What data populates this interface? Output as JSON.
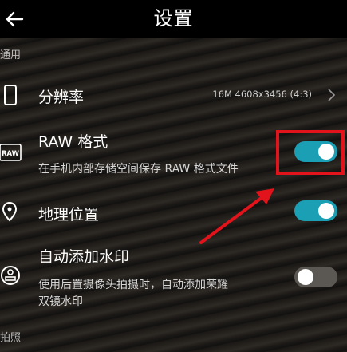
{
  "header": {
    "title": "设置"
  },
  "sections": {
    "general": "通用",
    "photo": "拍照"
  },
  "rows": {
    "resolution": {
      "label": "分辨率",
      "value": "16M 4608x3456 (4:3)"
    },
    "raw": {
      "label": "RAW 格式",
      "description": "在手机内部存储空间保存 RAW 格式文件",
      "icon_text": "RAW",
      "enabled": true
    },
    "location": {
      "label": "地理位置",
      "enabled": true
    },
    "watermark": {
      "label": "自动添加水印",
      "description_line1": "使用后置摄像头拍摄时，自动添加荣耀",
      "description_line2": "双镜水印",
      "enabled": false
    }
  },
  "colors": {
    "toggle_on": "#1b9fb5",
    "toggle_off": "#5b5853",
    "annotation": "#e3131b",
    "header_bg": "#000000"
  },
  "icons": {
    "back": "arrow-left-icon",
    "resolution": "phone-outline-icon",
    "raw": "raw-badge-icon",
    "location": "location-pin-icon",
    "watermark": "stamp-icon",
    "chevron": "chevron-right-icon"
  }
}
